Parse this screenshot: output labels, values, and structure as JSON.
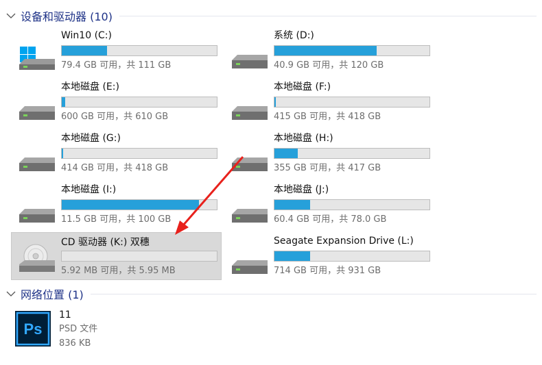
{
  "sections": {
    "devices_title": "设备和驱动器 (10)",
    "network_title": "网络位置 (1)"
  },
  "drives": [
    {
      "name": "Win10 (C:)",
      "space": "79.4 GB 可用，共 111 GB",
      "used_fraction": 0.29,
      "icon": "windows-drive-icon"
    },
    {
      "name": "系统 (D:)",
      "space": "40.9 GB 可用，共 120 GB",
      "used_fraction": 0.66,
      "icon": "hard-drive-icon"
    },
    {
      "name": "本地磁盘 (E:)",
      "space": "600 GB 可用，共 610 GB",
      "used_fraction": 0.02,
      "icon": "hard-drive-icon"
    },
    {
      "name": "本地磁盘 (F:)",
      "space": "415 GB 可用，共 418 GB",
      "used_fraction": 0.01,
      "icon": "hard-drive-icon"
    },
    {
      "name": "本地磁盘 (G:)",
      "space": "414 GB 可用，共 418 GB",
      "used_fraction": 0.01,
      "icon": "hard-drive-icon"
    },
    {
      "name": "本地磁盘 (H:)",
      "space": "355 GB 可用，共 417 GB",
      "used_fraction": 0.15,
      "icon": "hard-drive-icon"
    },
    {
      "name": "本地磁盘 (I:)",
      "space": "11.5 GB 可用，共 100 GB",
      "used_fraction": 0.885,
      "icon": "hard-drive-icon"
    },
    {
      "name": "本地磁盘 (J:)",
      "space": "60.4 GB 可用，共 78.0 GB",
      "used_fraction": 0.23,
      "icon": "hard-drive-icon"
    },
    {
      "name": "CD 驱动器 (K:) 双穗",
      "space": "5.92 MB 可用，共 5.95 MB",
      "used_fraction": 0.0,
      "icon": "cd-drive-icon",
      "selected": true
    },
    {
      "name": "Seagate Expansion Drive (L:)",
      "space": "714 GB 可用，共 931 GB",
      "used_fraction": 0.23,
      "icon": "hard-drive-icon"
    }
  ],
  "network": {
    "file_name": "11",
    "file_type": "PSD 文件",
    "file_size": "836 KB",
    "icon": "photoshop-file-icon",
    "icon_text": "Ps"
  },
  "colors": {
    "header": "#1e3287",
    "bar_fill": "#26a0da",
    "bar_bg": "#e6e6e6",
    "selection": "#d9d9d9",
    "annotation_arrow": "#e8211c"
  }
}
